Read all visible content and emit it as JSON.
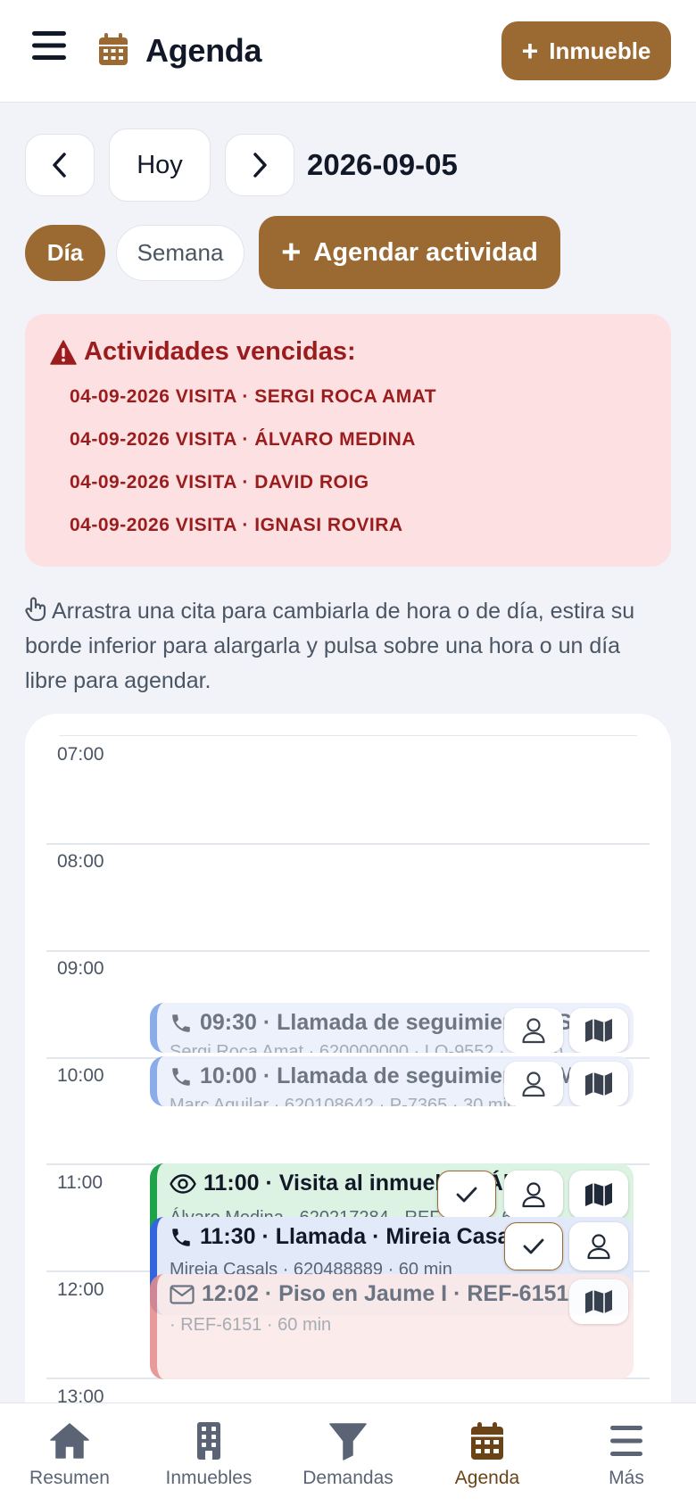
{
  "header": {
    "title": "Agenda",
    "new_property_label": "Inmueble"
  },
  "date_nav": {
    "today_label": "Hoy",
    "current_date": "2026-09-05"
  },
  "view_toggle": {
    "day_label": "Día",
    "week_label": "Semana",
    "active": "Día"
  },
  "schedule_button_label": "Agendar actividad",
  "overdue": {
    "title": "Actividades vencidas:",
    "items": [
      "04-09-2026 VISITA · SERGI ROCA AMAT",
      "04-09-2026 VISITA · ÁLVARO MEDINA",
      "04-09-2026 VISITA · DAVID ROIG",
      "04-09-2026 VISITA · IGNASI ROVIRA"
    ]
  },
  "hint_text": "Arrastra una cita para cambiarla de hora o de día, estira su borde inferior para alargarla y pulsa sobre una hora o un día libre para agendar.",
  "calendar": {
    "hours": [
      "07:00",
      "08:00",
      "09:00",
      "10:00",
      "11:00",
      "12:00",
      "13:00"
    ],
    "events": [
      {
        "icon": "phone-icon",
        "title": "09:30 · Llamada de seguimiento · S",
        "subtitle": "Sergi Roca Amat · 620000000 · LO-9552 · 30 min",
        "accent": "#7aa2e8",
        "bg": "#eaf0fb",
        "muted": true
      },
      {
        "icon": "phone-icon",
        "title": "10:00 · Llamada de seguimiento · M",
        "subtitle": "Marc Aguilar · 620108642 · P-7365 · 30 min",
        "accent": "#7aa2e8",
        "bg": "#eaf0fb",
        "muted": true
      },
      {
        "icon": "eye-icon",
        "title": "11:00 · Visita al inmueble · Álvaro",
        "subtitle": "Álvaro Medina · 620217284 · REF-0000 · 60 min",
        "accent": "#1fa34a",
        "bg": "#dcf2e2",
        "muted": false
      },
      {
        "icon": "phone-icon",
        "title": "11:30 · Llamada · Mireia Casals",
        "subtitle": "Mireia Casals · 620488889 · 60 min",
        "accent": "#3366dd",
        "bg": "#e2e9f8",
        "muted": false
      },
      {
        "icon": "mail-icon",
        "title": "12:02 · Piso en Jaume I · REF-6151",
        "subtitle": "· REF-6151 · 60 min",
        "accent": "#e58c8c",
        "bg": "#fbe9e8",
        "muted": true
      }
    ]
  },
  "bottom_nav": [
    {
      "label": "Resumen",
      "icon": "home-icon"
    },
    {
      "label": "Inmuebles",
      "icon": "building-icon"
    },
    {
      "label": "Demandas",
      "icon": "filter-icon"
    },
    {
      "label": "Agenda",
      "icon": "calendar-icon",
      "active": true
    },
    {
      "label": "Más",
      "icon": "menu-icon"
    }
  ],
  "colors": {
    "accent": "#9b6a33",
    "danger": "#9b1c1c",
    "danger_bg": "#fde0e1",
    "background": "#f1f3f8"
  }
}
